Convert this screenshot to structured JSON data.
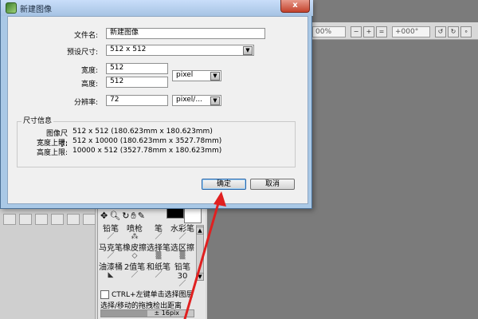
{
  "background": {
    "toolbar": {
      "field1": "00%",
      "field2": "+000°"
    },
    "tools": {
      "row1": [
        {
          "label": "铅笔",
          "icon": "pencil-icon"
        },
        {
          "label": "喷枪",
          "icon": "airbrush-icon"
        },
        {
          "label": "笔",
          "icon": "brush-icon"
        },
        {
          "label": "水彩笔",
          "icon": "watercolor-icon"
        }
      ],
      "row2": [
        {
          "label": "马克笔",
          "icon": "marker-icon"
        },
        {
          "label": "橡皮擦",
          "icon": "eraser-icon"
        },
        {
          "label": "选择笔",
          "icon": "select-pen-icon"
        },
        {
          "label": "选区擦",
          "icon": "select-eraser-icon"
        }
      ],
      "row3": [
        {
          "label": "油漆桶",
          "icon": "bucket-icon"
        },
        {
          "label": "2值笔",
          "icon": "binary-pen-icon"
        },
        {
          "label": "和纸笔",
          "icon": "washi-pen-icon"
        },
        {
          "label": "铅笔30",
          "icon": "pencil30-icon"
        }
      ]
    },
    "ctrl_label": "CTRL+左键单击选择图层",
    "dist_label": "选择/移动的拖拽检出距离",
    "dist_value": "± 16pix",
    "dist_fraction": 0.5
  },
  "dialog": {
    "title": "新建图像",
    "close_label": "x",
    "filename_label": "文件名:",
    "filename_value": "新建图像",
    "preset_label": "预设尺寸:",
    "preset_value": "512 x  512",
    "width_label": "宽度:",
    "width_value": "512",
    "height_label": "高度:",
    "height_value": "512",
    "unit_value": "pixel",
    "res_label": "分辨率:",
    "res_value": "72",
    "res_unit_value": "pixel/...",
    "info_title": "尺寸信息",
    "info_rows": [
      {
        "label": "图像尺寸:",
        "value": "512 x 512  (180.623mm x 180.623mm)"
      },
      {
        "label": "宽度上限:",
        "value": "512 x 10000  (180.623mm x 3527.78mm)"
      },
      {
        "label": "高度上限:",
        "value": "10000 x 512  (3527.78mm x 180.623mm)"
      }
    ],
    "ok_label": "确定",
    "cancel_label": "取消"
  },
  "annotation": {
    "color": "#e02020"
  }
}
